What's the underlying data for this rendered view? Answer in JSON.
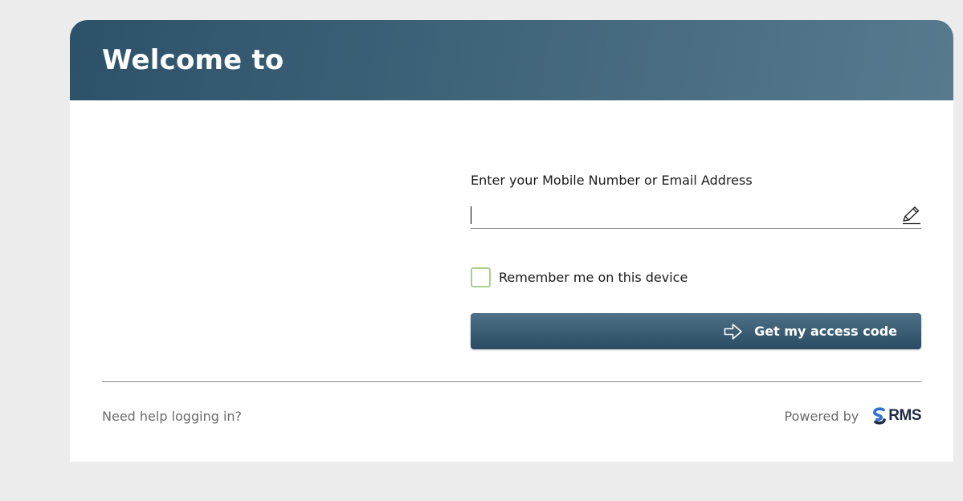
{
  "header": {
    "title": "Welcome to"
  },
  "form": {
    "field_label": "Enter your Mobile Number or Email Address",
    "field_value": "",
    "field_icon": "pencil-icon",
    "remember_label": "Remember me on this device",
    "remember_checked": false,
    "submit_label": "Get my access code",
    "submit_icon": "arrow-right-icon"
  },
  "footer": {
    "help_link": "Need help logging in?",
    "powered_by": "Powered by",
    "logo_text": "RMS",
    "logo_icon": "rms-logo-icon"
  },
  "colors": {
    "header_start": "#2c5169",
    "header_end": "#587a8d",
    "button_top": "#4e7187",
    "button_bottom": "#2a4c62",
    "checkbox_border": "#a9d18e",
    "logo_blue": "#2f6fd6",
    "logo_navy": "#1f2a44"
  }
}
